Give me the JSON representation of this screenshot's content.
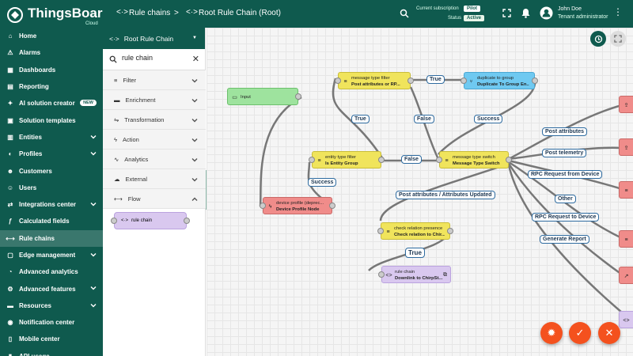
{
  "app": {
    "name": "ThingsBoard",
    "sub": "Cloud"
  },
  "header": {
    "breadcrumb_1": "Rule chains",
    "breadcrumb_sep": ">",
    "breadcrumb_2": "Root Rule Chain (Root)",
    "subscription_label": "Current subscription",
    "subscription_value": "Pilot",
    "status_label": "Status",
    "status_value": "Active",
    "user_name": "John Doe",
    "user_role": "Tenant administrator"
  },
  "nav": [
    {
      "label": "Home",
      "icon": "home-icon"
    },
    {
      "label": "Alarms",
      "icon": "alarm-icon"
    },
    {
      "label": "Dashboards",
      "icon": "dashboard-icon"
    },
    {
      "label": "Reporting",
      "icon": "report-icon"
    },
    {
      "label": "AI solution creator",
      "icon": "ai-icon",
      "badge": "NEW"
    },
    {
      "label": "Solution templates",
      "icon": "template-icon"
    },
    {
      "label": "Entities",
      "icon": "entities-icon",
      "chevron": true
    },
    {
      "label": "Profiles",
      "icon": "profiles-icon",
      "chevron": true
    },
    {
      "label": "Customers",
      "icon": "customers-icon"
    },
    {
      "label": "Users",
      "icon": "users-icon"
    },
    {
      "label": "Integrations center",
      "icon": "integrations-icon",
      "chevron": true
    },
    {
      "label": "Calculated fields",
      "icon": "function-icon"
    },
    {
      "label": "Rule chains",
      "icon": "rule-chain-icon",
      "active": true
    },
    {
      "label": "Edge management",
      "icon": "edge-icon",
      "chevron": true
    },
    {
      "label": "Advanced analytics",
      "icon": "analytics-icon"
    },
    {
      "label": "Advanced features",
      "icon": "features-icon",
      "chevron": true
    },
    {
      "label": "Resources",
      "icon": "folder-icon",
      "chevron": true
    },
    {
      "label": "Notification center",
      "icon": "notification-icon"
    },
    {
      "label": "Mobile center",
      "icon": "mobile-icon"
    },
    {
      "label": "API usage",
      "icon": "api-icon"
    }
  ],
  "library": {
    "title": "Root Rule Chain",
    "search_value": "rule chain",
    "sections": [
      "Filter",
      "Enrichment",
      "Transformation",
      "Action",
      "Analytics",
      "External",
      "Flow"
    ],
    "flow_node": "rule chain"
  },
  "nodes": {
    "input": {
      "name": "Input"
    },
    "mtf1": {
      "type": "message type filter",
      "name": "Post attributes or RP..."
    },
    "dup": {
      "type": "duplicate to group",
      "name": "Duplicate To Group En..."
    },
    "etf": {
      "type": "entity type filter",
      "name": "Is Entity Group"
    },
    "mts": {
      "type": "message type switch",
      "name": "Message Type Switch"
    },
    "dp": {
      "type": "device profile (deprec...",
      "name": "Device Profile Node"
    },
    "crp": {
      "type": "check relation presence",
      "name": "Check relation to Chir..."
    },
    "rc": {
      "type": "rule chain",
      "name": "Downlink to ChirpSt..."
    }
  },
  "edges": {
    "true1": "True",
    "false1": "False",
    "success1": "Success",
    "true2": "True",
    "false2": "False",
    "success2": "Success",
    "post_attributes": "Post attributes",
    "post_telemetry": "Post telemetry",
    "rpc_from": "RPC Request from Device",
    "other": "Other",
    "rpc_to": "RPC Request to Device",
    "generate_report": "Generate Report",
    "pa_updated": "Post attributes / Attributes Updated",
    "true3": "True"
  },
  "colors": {
    "nav": "#0f5a4e",
    "fab": "#f4511e"
  }
}
